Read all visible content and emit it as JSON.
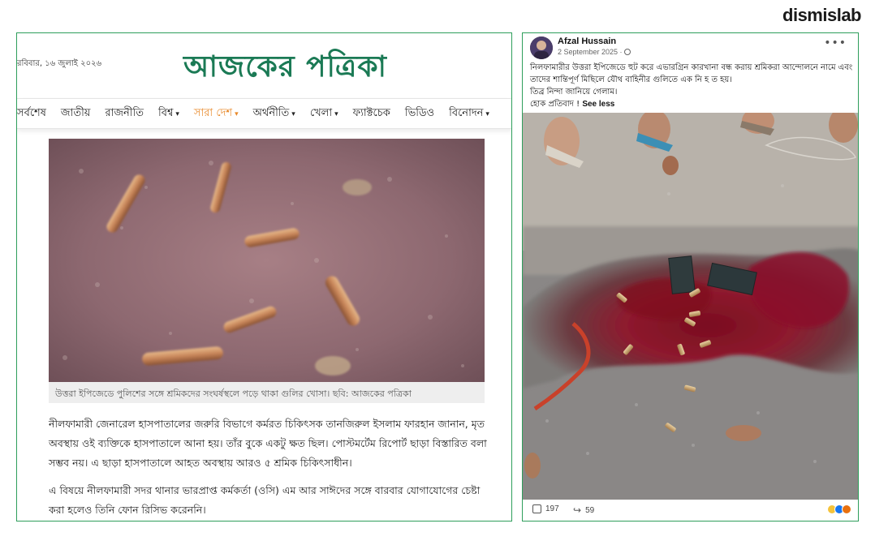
{
  "brand": {
    "name": "dismislab"
  },
  "newspaper": {
    "date": "রবিবার, ১৬ জুলাই ২০২৬",
    "logo": "আজকের পত্রিকা",
    "nav": [
      {
        "label": "সর্বশেষ",
        "dropdown": false,
        "active": false
      },
      {
        "label": "জাতীয়",
        "dropdown": false,
        "active": false
      },
      {
        "label": "রাজনীতি",
        "dropdown": false,
        "active": false
      },
      {
        "label": "বিশ্ব",
        "dropdown": true,
        "active": false
      },
      {
        "label": "সারা দেশ",
        "dropdown": true,
        "active": true
      },
      {
        "label": "অর্থনীতি",
        "dropdown": true,
        "active": false
      },
      {
        "label": "খেলা",
        "dropdown": true,
        "active": false
      },
      {
        "label": "ফ্যাক্টচেক",
        "dropdown": false,
        "active": false
      },
      {
        "label": "ভিডিও",
        "dropdown": false,
        "active": false
      },
      {
        "label": "বিনোদন",
        "dropdown": true,
        "active": false
      }
    ],
    "caption": "উত্তরা ইপিজেডে পুলিশের সঙ্গে শ্রমিকদের সংঘর্ষস্থলে পড়ে থাকা গুলির খোসা। ছবি: আজকের পত্রিকা",
    "paragraphs": [
      "নীলফামারী জেনারেল হাসপাতালের জরুরি বিভাগে কর্মরত চিকিৎসক তানজিরুল ইসলাম ফারহান জানান, মৃত অবস্থায় ওই ব্যক্তিকে হাসপাতালে আনা হয়। তাঁর বুকে একটু ক্ষত ছিল। পোস্টমর্টেম রিপোর্ট ছাড়া বিস্তারিত বলা সম্ভব নয়। এ ছাড়া হাসপাতালে আহত অবস্থায় আরও ৫ শ্রমিক চিকিৎসাধীন।",
      "এ বিষয়ে নীলফামারী সদর থানার ভারপ্রাপ্ত কর্মকর্তা (ওসি) এম আর সাঈদের সঙ্গে বারবার যোগাযোগের চেষ্টা করা হলেও তিনি ফোন রিসিভ করেননি।"
    ],
    "accent_color": "#1b7a55",
    "active_color": "#e8892a"
  },
  "facebook_post": {
    "author": "Afzal Hussain",
    "date": "2 September 2025 · ",
    "text_lines": [
      "নিলফামারীর উত্তরা ইপিজেডে হুট করে এভারগ্রিন কারখানা বন্ধ করায় শ্রমিকরা আন্দোলনে নামে এবং তাদের শান্তিপূর্ণ মিছিলে যৌথ বাহিনীর গুলিতে এক নি হ ত হয়।",
      "তিব্র নিন্দা জানিয়ে গেলাম।",
      "হোক প্রতিবাদ !"
    ],
    "see_less": "See less",
    "likes": "197",
    "shares": "59",
    "reactions": [
      "sad",
      "like",
      "angry"
    ]
  }
}
